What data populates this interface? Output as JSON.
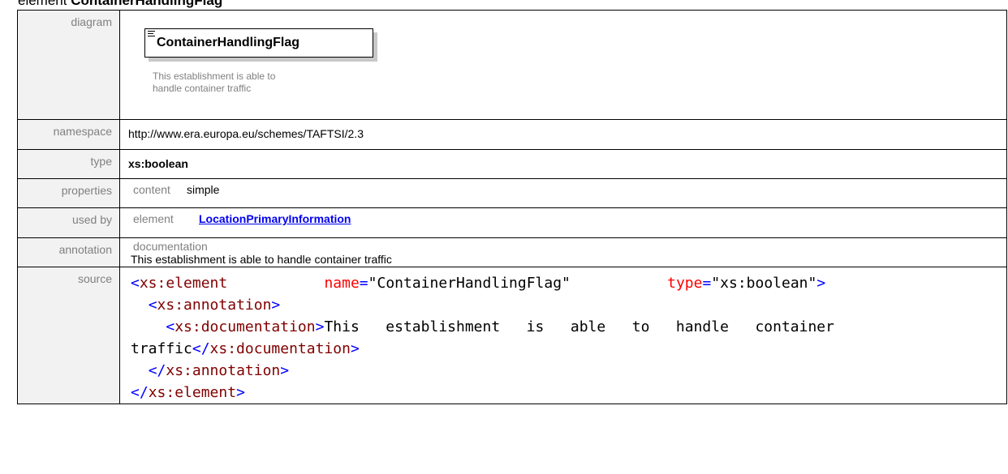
{
  "heading": {
    "prefix": "element ",
    "name": "ContainerHandlingFlag"
  },
  "rows": {
    "diagram": {
      "label": "diagram",
      "box_name": "ContainerHandlingFlag",
      "doc_line1": "This establishment is able to",
      "doc_line2": "handle container traffic"
    },
    "namespace": {
      "label": "namespace",
      "value": "http://www.era.europa.eu/schemes/TAFTSI/2.3"
    },
    "type": {
      "label": "type",
      "value": "xs:boolean"
    },
    "properties": {
      "label": "properties",
      "key": "content",
      "value": "simple"
    },
    "used_by": {
      "label": "used by",
      "key": "element",
      "link": "LocationPrimaryInformation"
    },
    "annotation": {
      "label": "annotation",
      "key": "documentation",
      "value": "This establishment is able to handle container traffic"
    },
    "source": {
      "label": "source",
      "l1_open": "<",
      "l1_tag": "xs:element",
      "l1_attr1": "name",
      "l1_eq1": "=",
      "l1_val1": "\"ContainerHandlingFlag\"",
      "l1_attr2": "type",
      "l1_eq2": "=",
      "l1_val2": "\"xs:boolean\"",
      "l1_close": ">",
      "l2_open": "<",
      "l2_tag": "xs:annotation",
      "l2_close": ">",
      "l3_open": "<",
      "l3_tag": "xs:documentation",
      "l3_close": ">",
      "l3_text": "This   establishment   is   able   to   handle   container",
      "l4_text": "traffic",
      "l4_open": "</",
      "l4_tag": "xs:documentation",
      "l4_close": ">",
      "l5_open": "</",
      "l5_tag": "xs:annotation",
      "l5_close": ">",
      "l6_open": "</",
      "l6_tag": "xs:element",
      "l6_close": ">"
    }
  }
}
